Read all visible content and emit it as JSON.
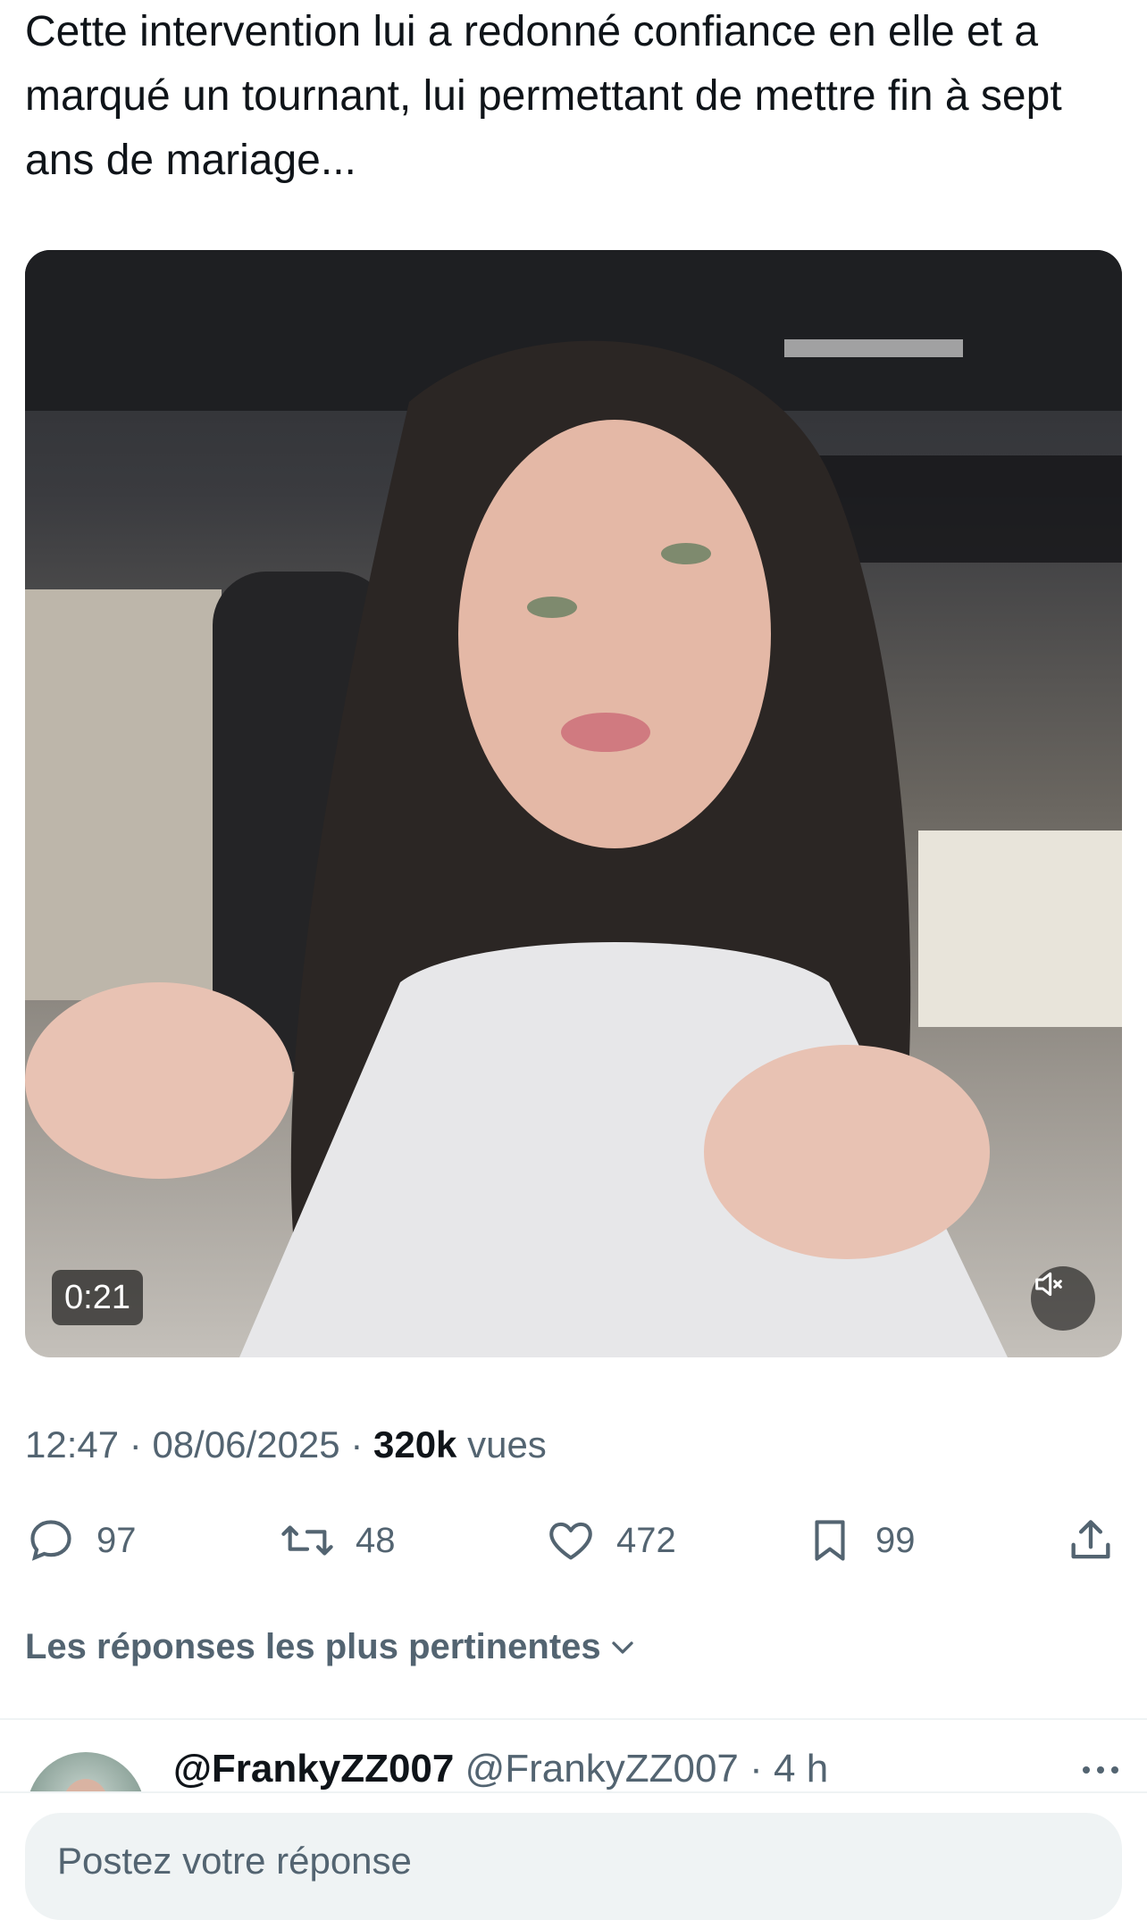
{
  "tweet": {
    "text": "Cette intervention lui a redonné confiance en elle et a marqué un tournant, lui permettant de mettre fin à sept ans de mariage..."
  },
  "media": {
    "duration": "0:21",
    "mute_icon": "speaker-muted-icon"
  },
  "meta": {
    "time": "12:47",
    "sep1": " · ",
    "date": "08/06/2025",
    "sep2": " · ",
    "views": "320k",
    "views_label": " vues"
  },
  "actions": {
    "reply_count": "97",
    "retweet_count": "48",
    "like_count": "472",
    "bookmark_count": "99"
  },
  "replies_filter": {
    "label": "Les réponses les plus pertinentes"
  },
  "reply": {
    "name": "@FrankyZZ007",
    "handle": "@FrankyZZ007",
    "sep": " · ",
    "time": "4 h"
  },
  "composer": {
    "placeholder": "Postez votre réponse"
  },
  "colors": {
    "text": "#0f1419",
    "secondary": "#536471",
    "divider": "#eff3f4"
  }
}
